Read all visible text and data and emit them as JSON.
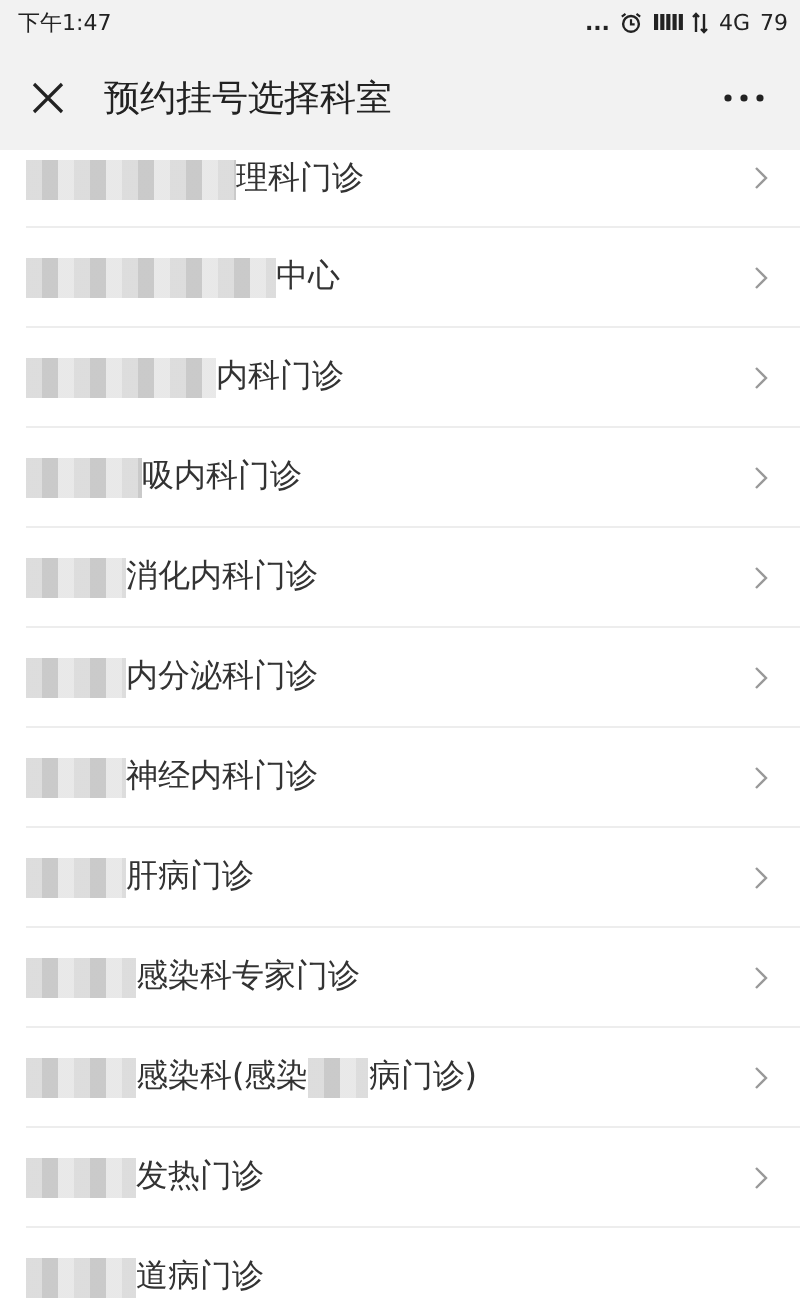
{
  "status_bar": {
    "time": "下午1:47",
    "dots": "...",
    "signal": "IIIII",
    "network": "4G",
    "battery": "79"
  },
  "header": {
    "title": "预约挂号选择科室"
  },
  "departments": [
    {
      "parts": [
        "理科门诊"
      ],
      "arrow": true
    },
    {
      "parts": [
        "中心"
      ],
      "arrow": true
    },
    {
      "parts": [
        "内科门诊"
      ],
      "arrow": true
    },
    {
      "parts": [
        "吸内科门诊"
      ],
      "arrow": true
    },
    {
      "parts": [
        "消化内科门诊"
      ],
      "arrow": true
    },
    {
      "parts": [
        "内分泌科门诊"
      ],
      "arrow": true
    },
    {
      "parts": [
        "神经内科门诊"
      ],
      "arrow": true
    },
    {
      "parts": [
        "肝病门诊"
      ],
      "arrow": true
    },
    {
      "parts": [
        "感染科专家门诊"
      ],
      "arrow": true
    },
    {
      "parts": [
        "感染科(感染",
        "病门诊)"
      ],
      "arrow": true
    },
    {
      "parts": [
        "发热门诊"
      ],
      "arrow": true
    },
    {
      "parts": [
        "道病门诊"
      ],
      "arrow": false
    }
  ]
}
